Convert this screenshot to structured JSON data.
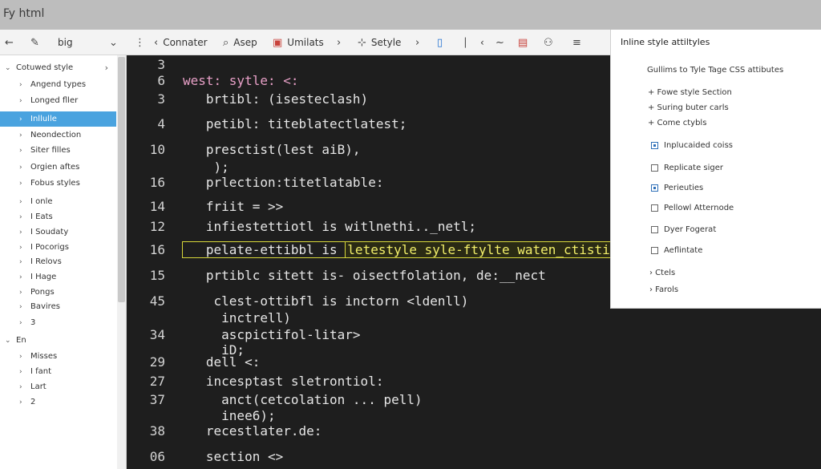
{
  "window": {
    "title": "Fy html"
  },
  "toolbar": {
    "back": "←",
    "pencil": "✎",
    "file_label": "big",
    "chevron": "⌄",
    "items": [
      {
        "icon": "⋮",
        "label": ""
      },
      {
        "icon": "‹",
        "label": "Connater"
      },
      {
        "icon": "⌕",
        "label": "Asep"
      },
      {
        "icon": "▣",
        "label": "Umilats"
      },
      {
        "icon": "›",
        "label": ""
      },
      {
        "icon": "⊹",
        "label": "Setyle"
      },
      {
        "icon": "›",
        "label": ""
      },
      {
        "icon": "▯",
        "label": ""
      },
      {
        "icon": "⎸",
        "label": "‹"
      },
      {
        "icon": "~",
        "label": ""
      },
      {
        "icon": "▤",
        "label": ""
      },
      {
        "icon": "⚇",
        "label": ""
      },
      {
        "icon": "≡",
        "label": ""
      }
    ]
  },
  "sidebar": {
    "items": [
      {
        "label": "Cotuwed style",
        "arrow": "⌄",
        "chev": "›"
      },
      {
        "label": "Angend types",
        "arrow": "›",
        "chev": ""
      },
      {
        "label": "Longed fller",
        "arrow": "›",
        "chev": ""
      },
      {
        "label": "Inllulle",
        "arrow": "›",
        "chev": "",
        "selected": true
      },
      {
        "label": "Neondection",
        "arrow": "›",
        "chev": ""
      },
      {
        "label": "Siter filles",
        "arrow": "›",
        "chev": ""
      },
      {
        "label": "Orgien aftes",
        "arrow": "›",
        "chev": ""
      },
      {
        "label": "Fobus styles",
        "arrow": "›",
        "chev": ""
      },
      {
        "label": "I onle",
        "arrow": "›",
        "chev": ""
      },
      {
        "label": "I Eats",
        "arrow": "›",
        "chev": ""
      },
      {
        "label": "I Soudaty",
        "arrow": "›",
        "chev": ""
      },
      {
        "label": "I Pocorigs",
        "arrow": "›",
        "chev": ""
      },
      {
        "label": "I Relovs",
        "arrow": "›",
        "chev": ""
      },
      {
        "label": "I Hage",
        "arrow": "›",
        "chev": ""
      },
      {
        "label": "Pongs",
        "arrow": "›",
        "chev": ""
      },
      {
        "label": "Bavires",
        "arrow": "›",
        "chev": ""
      },
      {
        "label": "3",
        "arrow": "›",
        "chev": ""
      },
      {
        "label": "En",
        "arrow": "⌄",
        "chev": ""
      },
      {
        "label": "Misses",
        "arrow": "›",
        "chev": ""
      },
      {
        "label": "I fant",
        "arrow": "›",
        "chev": ""
      },
      {
        "label": "Lart",
        "arrow": "›",
        "chev": ""
      },
      {
        "label": "2",
        "arrow": "›",
        "chev": ""
      }
    ]
  },
  "editor": {
    "lines": [
      {
        "num": "3",
        "code": ""
      },
      {
        "num": "6",
        "code": "west: sytle: <:"
      },
      {
        "num": "3",
        "code": "   brtibl: (isesteclash)"
      },
      {
        "num": "4",
        "code": "   petibl: titeblatectlatest;"
      },
      {
        "num": "10",
        "code": "   presctist(lest aiB),"
      },
      {
        "num": "",
        "code": "    );"
      },
      {
        "num": "16",
        "code": "   prlection:titetlatable:"
      },
      {
        "num": "14",
        "code": "   friit = >>"
      },
      {
        "num": "12",
        "code": "   infiestettiotl is witlnethi.._netl;"
      },
      {
        "num": "16",
        "code": "   pelate-ettibbl is ",
        "highlight": "letestyle syle-ftylte waten_ctistile"
      },
      {
        "num": "15",
        "code": "   prtiblc sitett is- oisectfolation, de:__nect"
      },
      {
        "num": "45",
        "code": "    clest-ottibfl is inctorn <ldenll)"
      },
      {
        "num": "",
        "code": "     inctrell)"
      },
      {
        "num": "34",
        "code": "     ascpictifol-litar>"
      },
      {
        "num": "",
        "code": "     iD;"
      },
      {
        "num": "29",
        "code": "   dell <:"
      },
      {
        "num": "27",
        "code": "   incesptast sletrontiol:"
      },
      {
        "num": "37",
        "code": "     anct(cetcolation ... pell)"
      },
      {
        "num": "",
        "code": "     inee6);"
      },
      {
        "num": "38",
        "code": "   recestlater.de:"
      },
      {
        "num": "06",
        "code": "   section <>"
      }
    ]
  },
  "panel": {
    "title": "Inline style attiltyles",
    "subtitle": "Gullims to Tyle Tage CSS attibutes",
    "bullets": [
      "+ Fowe style Section",
      "+ Suring buter carls",
      "+ Come ctybls"
    ],
    "checks": [
      {
        "label": "Inplucaided coiss",
        "checked": true
      },
      {
        "label": "Replicate siger",
        "checked": false
      },
      {
        "label": "Perieuties",
        "checked": true
      },
      {
        "label": "Pellowl Atternode",
        "checked": false
      },
      {
        "label": "Dyer Fogerat",
        "checked": false
      },
      {
        "label": "Aeflintate",
        "checked": false
      }
    ],
    "links": [
      "› Ctels",
      "› Farols"
    ]
  },
  "colors": {
    "accent": "#4aa3df",
    "highlight": "#d7d73a",
    "editor_bg": "#1e1e1e"
  }
}
